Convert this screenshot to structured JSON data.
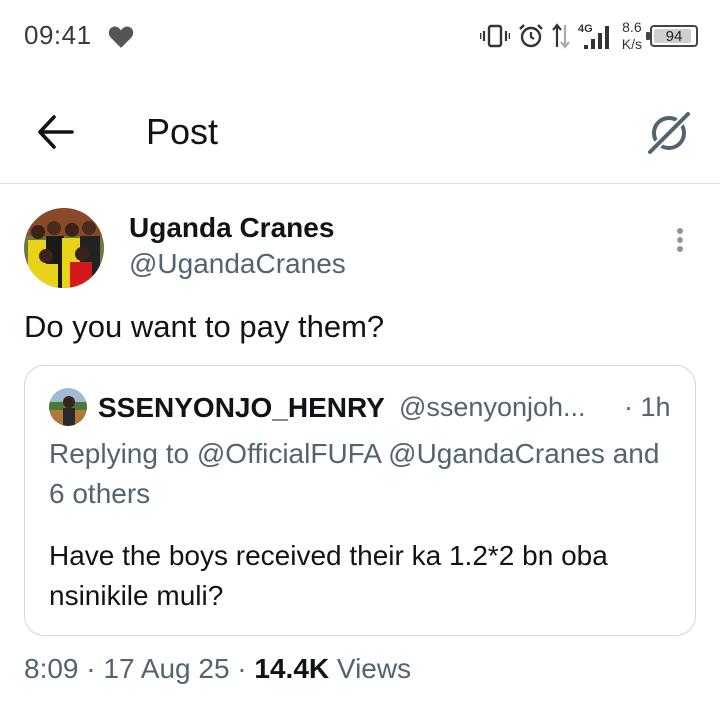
{
  "status_bar": {
    "time": "09:41",
    "network": "4G",
    "speed_value": "8.6",
    "speed_unit": "K/s",
    "battery": "94"
  },
  "header": {
    "title": "Post"
  },
  "post": {
    "display_name": "Uganda Cranes",
    "handle": "@UgandaCranes",
    "text": "Do you want to pay them?",
    "time": "8:09",
    "date": "17 Aug 25",
    "views_count": "14.4K",
    "views_label": "Views"
  },
  "quoted": {
    "display_name": "SSENYONJO_HENRY",
    "handle": "@ssenyonjoh...",
    "time": "· 1h",
    "replying_to": "Replying to @OfficialFUFA @UgandaCranes and 6 others",
    "text": "Have the boys received their ka 1.2*2 bn oba nsinikile muli?"
  },
  "icons": {
    "back": "arrow-left-icon",
    "grok": "grok-icon",
    "more": "more-vertical-icon",
    "heart": "heart-icon"
  },
  "colors": {
    "text_primary": "#0f1419",
    "text_secondary": "#536471",
    "border": "#cfd9de"
  }
}
